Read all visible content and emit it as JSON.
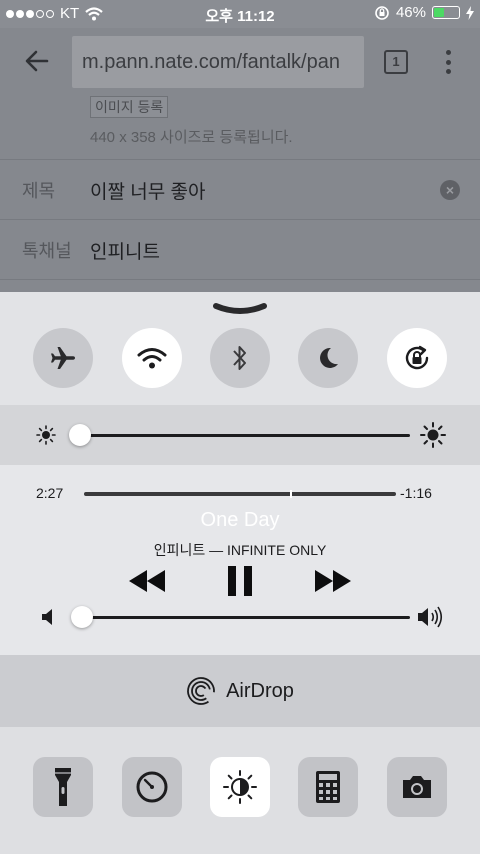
{
  "status_bar": {
    "carrier": "KT",
    "time": "오후 11:12",
    "battery_percent": "46%",
    "battery_level": 0.46
  },
  "browser": {
    "url": "m.pann.nate.com/fantalk/pan",
    "tab_count": "1",
    "image_register_label": "이미지 등록",
    "size_note": "440 x 358 사이즈로 등록됩니다.",
    "title_label": "제목",
    "title_value": "이짤 너무 좋아",
    "channel_label": "톡채널",
    "channel_value": "인피니트"
  },
  "control_center": {
    "toggles": [
      {
        "icon": "airplane-icon",
        "on": false
      },
      {
        "icon": "wifi-icon",
        "on": true
      },
      {
        "icon": "bluetooth-icon",
        "on": false
      },
      {
        "icon": "moon-icon",
        "on": false
      },
      {
        "icon": "rotation-lock-icon",
        "on": true
      }
    ],
    "brightness_level": 0.0,
    "media": {
      "elapsed": "2:27",
      "remaining": "-1:16",
      "progress": 0.66,
      "title": "One Day",
      "artist_album": "인피니트 — INFINITE ONLY"
    },
    "volume_level": 0.0,
    "airdrop_label": "AirDrop",
    "shortcuts": [
      {
        "icon": "flashlight-icon",
        "on": false
      },
      {
        "icon": "timer-icon",
        "on": false
      },
      {
        "icon": "night-shift-icon",
        "on": true
      },
      {
        "icon": "calculator-icon",
        "on": false
      },
      {
        "icon": "camera-icon",
        "on": false
      }
    ],
    "colors": {
      "panel": "#e2e3e6",
      "toggle_off": "#c7c8cc",
      "toggle_on": "#ffffff"
    }
  }
}
